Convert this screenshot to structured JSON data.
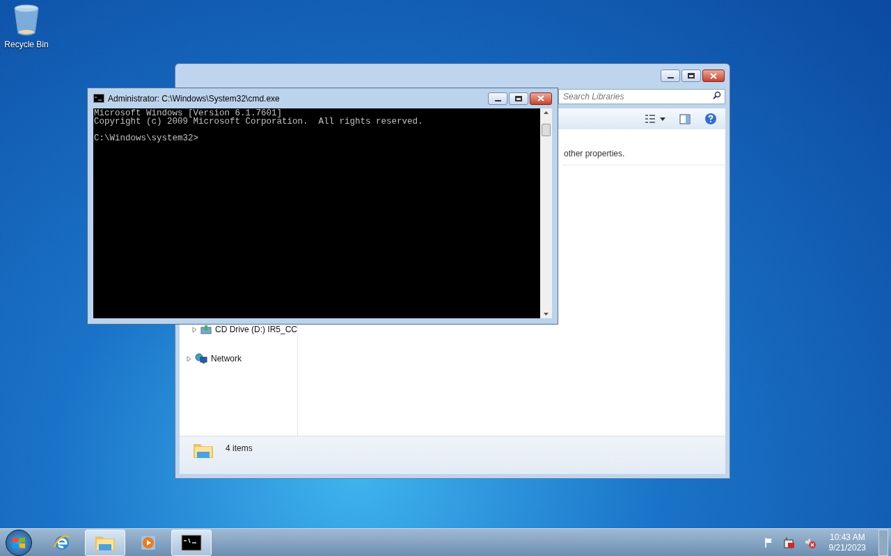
{
  "desktop_icons": [
    {
      "label": "Recycle Bin"
    }
  ],
  "explorer": {
    "search": {
      "placeholder": "Search Libraries"
    },
    "hint_text": "other properties.",
    "nav_items": [
      {
        "label": "CD Drive (D:) IR5_CC",
        "kind": "drive",
        "expanded": false
      },
      {
        "label": "Network",
        "kind": "network",
        "expanded": false
      }
    ],
    "status_bar": {
      "count": "4 items"
    }
  },
  "console": {
    "title": "Administrator: C:\\Windows\\System32\\cmd.exe",
    "lines": [
      "Microsoft Windows [Version 6.1.7601]",
      "Copyright (c) 2009 Microsoft Corporation.  All rights reserved."
    ],
    "prompt": "C:\\Windows\\system32>"
  },
  "taskbar": {
    "items": [
      {
        "kind": "browser",
        "running": false
      },
      {
        "kind": "folder",
        "running": true
      },
      {
        "kind": "media",
        "running": false
      },
      {
        "kind": "console",
        "running": true
      }
    ],
    "clock": {
      "time": "10:43 AM",
      "date": "9/21/2023"
    }
  }
}
